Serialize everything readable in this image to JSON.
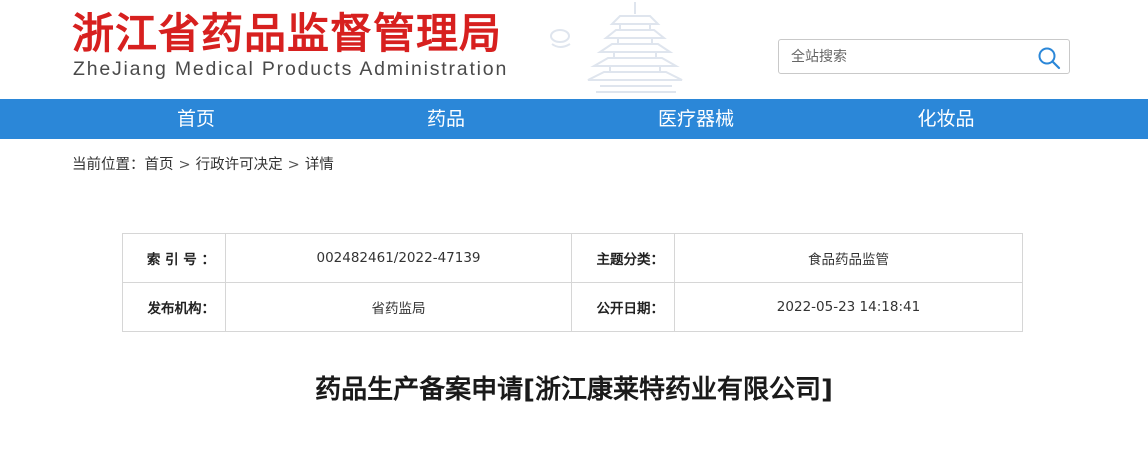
{
  "header": {
    "title_cn": "浙江省药品监督管理局",
    "title_en": "ZheJiang Medical Products Administration",
    "search_placeholder": "全站搜索",
    "search_icon": "search-icon",
    "decor_icon": "pagoda-icon"
  },
  "nav": {
    "items": [
      {
        "label": "首页"
      },
      {
        "label": "药品"
      },
      {
        "label": "医疗器械"
      },
      {
        "label": "化妆品"
      }
    ],
    "color": "#2b87d8"
  },
  "breadcrumb": {
    "prefix": "当前位置：",
    "items": [
      "首页",
      "行政许可决定",
      "详情"
    ],
    "separator": ">"
  },
  "info_table": {
    "rows": [
      [
        {
          "label": "索 引 号 ：",
          "value": "002482461/2022-47139"
        },
        {
          "label": "主题分类：",
          "value": "食品药品监管"
        }
      ],
      [
        {
          "label": "发布机构：",
          "value": "省药监局"
        },
        {
          "label": "公开日期：",
          "value": "2022-05-23 14:18:41"
        }
      ]
    ]
  },
  "document": {
    "title": "药品生产备案申请[浙江康莱特药业有限公司]"
  },
  "colors": {
    "brand_red": "#d7201f",
    "nav_blue": "#2b87d8"
  }
}
